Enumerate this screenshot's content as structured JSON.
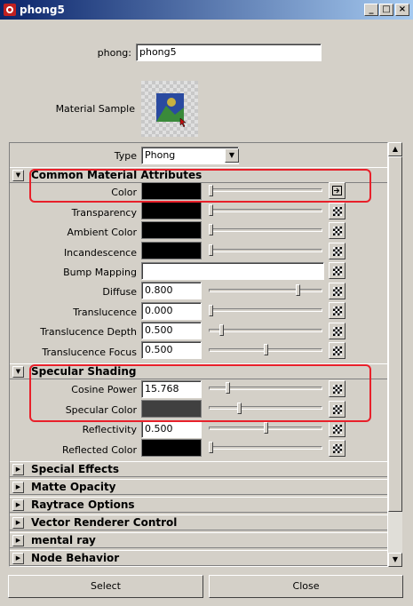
{
  "window": {
    "title": "phong5",
    "minimize": "_",
    "maximize": "□",
    "close": "×"
  },
  "header": {
    "name_label": "phong:",
    "name_value": "phong5",
    "sample_label": "Material Sample"
  },
  "type_row": {
    "label": "Type",
    "value": "Phong"
  },
  "common": {
    "title": "Common Material Attributes",
    "rows": [
      {
        "label": "Color"
      },
      {
        "label": "Transparency"
      },
      {
        "label": "Ambient Color"
      },
      {
        "label": "Incandescence"
      },
      {
        "label": "Bump Mapping"
      },
      {
        "label": "Diffuse",
        "value": "0.800"
      },
      {
        "label": "Translucence",
        "value": "0.000"
      },
      {
        "label": "Translucence Depth",
        "value": "0.500"
      },
      {
        "label": "Translucence Focus",
        "value": "0.500"
      }
    ]
  },
  "specular": {
    "title": "Specular Shading",
    "rows": [
      {
        "label": "Cosine Power",
        "value": "15.768"
      },
      {
        "label": "Specular Color"
      },
      {
        "label": "Reflectivity",
        "value": "0.500"
      },
      {
        "label": "Reflected Color"
      }
    ]
  },
  "collapsed_sections": [
    "Special Effects",
    "Matte Opacity",
    "Raytrace Options",
    "Vector Renderer Control",
    "mental ray",
    "Node Behavior"
  ],
  "buttons": {
    "select": "Select",
    "close": "Close"
  },
  "slider_levels": {
    "color": 0.0,
    "transparency": 0.0,
    "ambient": 0.0,
    "incandescence": 0.0,
    "diffuse": 0.8,
    "translucence": 0.0,
    "translucence_depth": 0.1,
    "translucence_focus": 0.5,
    "cosine_power": 0.15,
    "specular_color": 0.25,
    "reflectivity": 0.5,
    "reflected_color": 0.0
  },
  "colors": {
    "accent_highlight": "#e8202a",
    "color_swatch": "#000000",
    "specular_swatch": "#404040"
  }
}
